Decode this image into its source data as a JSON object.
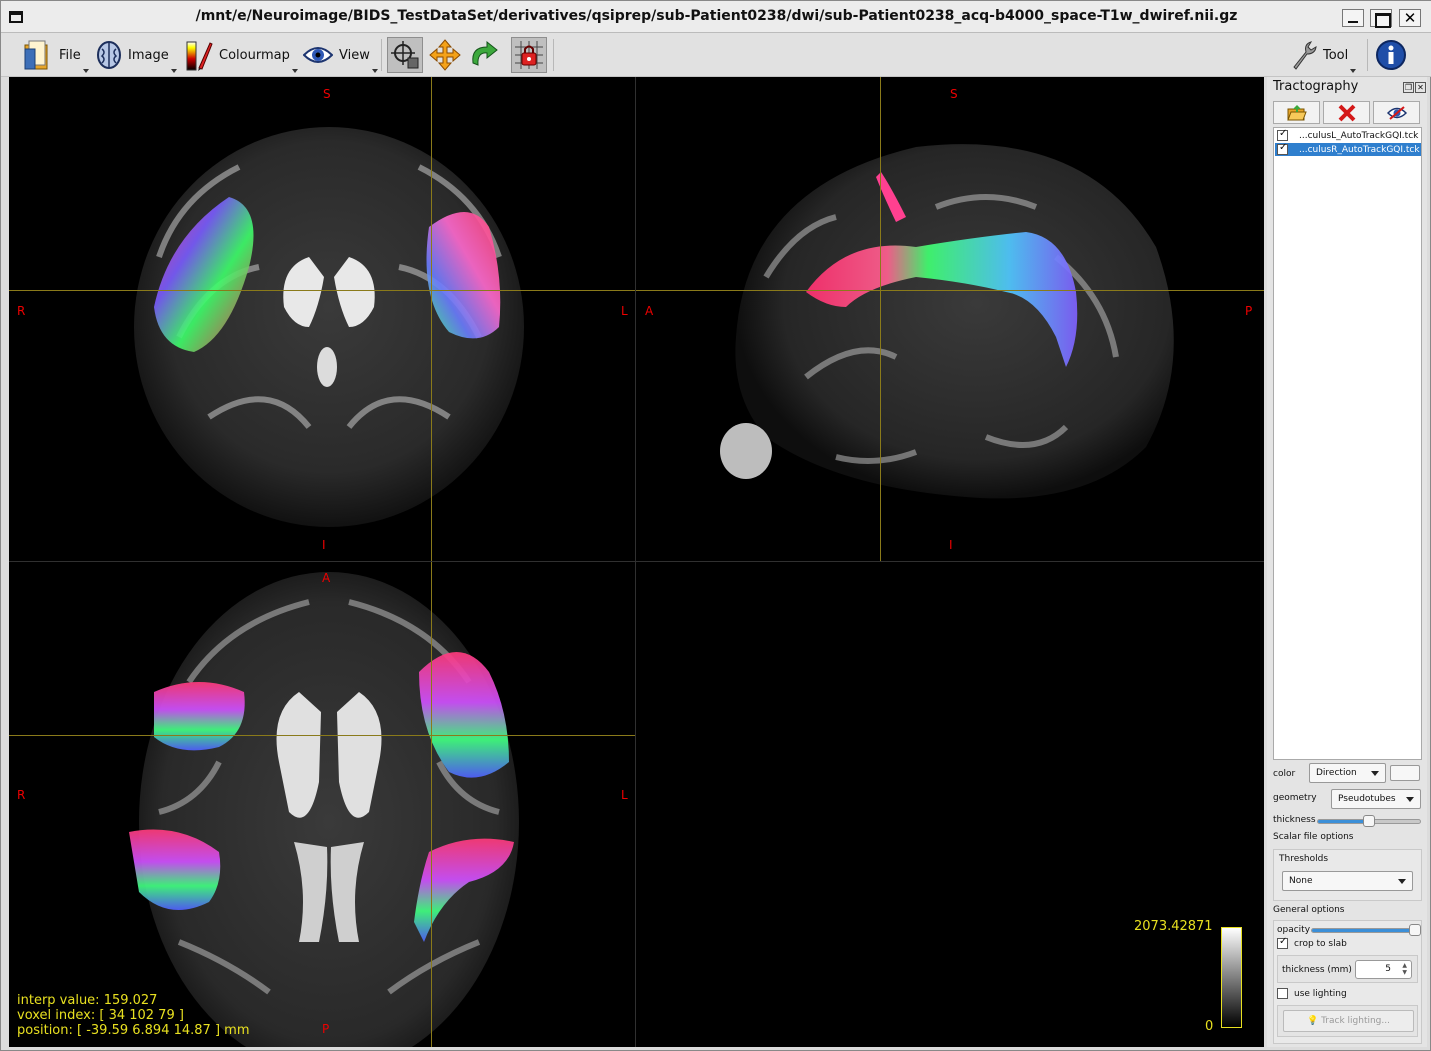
{
  "window": {
    "title": "/mnt/e/Neuroimage/BIDS_TestDataSet/derivatives/qsiprep/sub-Patient0238/dwi/sub-Patient0238_acq-b4000_space-T1w_dwiref.nii.gz",
    "close_glyph": "✕"
  },
  "toolbar": {
    "file_label": "File",
    "image_label": "Image",
    "colourmap_label": "Colourmap",
    "view_label": "View",
    "tool_label": "Tool"
  },
  "views": {
    "coronal": {
      "top": "S",
      "bottom": "I",
      "left": "R",
      "right": "L"
    },
    "sagittal": {
      "top": "S",
      "bottom": "I",
      "left": "A",
      "right": "P"
    },
    "axial": {
      "top": "A",
      "bottom": "P",
      "left": "R",
      "right": "L"
    },
    "info": {
      "interp": "interp value: 159.027",
      "voxel": "voxel index: [ 34 102 79 ]",
      "position": "position: [ -39.59 6.894 14.87 ] mm"
    },
    "colorbar": {
      "max": "2073.42871",
      "min": "0"
    },
    "crosshair_color": "#8a7a1a",
    "label_color": "#e00000",
    "info_color": "#e8e020"
  },
  "tractography": {
    "title": "Tractography",
    "tracks": [
      {
        "name": "...culusL_AutoTrackGQI.tck",
        "checked": true,
        "selected": false
      },
      {
        "name": "...culusR_AutoTrackGQI.tck",
        "checked": true,
        "selected": true
      }
    ],
    "color_label": "color",
    "color_value": "Direction",
    "geometry_label": "geometry",
    "geometry_value": "Pseudotubes",
    "thickness_label": "thickness",
    "thickness_level": 0.5,
    "scalar_heading": "Scalar file options",
    "thresholds_label": "Thresholds",
    "thresholds_value": "None",
    "general_heading": "General options",
    "opacity_label": "opacity",
    "opacity_level": 0.98,
    "crop_label": "crop to slab",
    "crop_checked": true,
    "slab_thickness_label": "thickness (mm)",
    "slab_thickness_value": "5",
    "lighting_label": "use lighting",
    "lighting_checked": false,
    "track_lighting_label": "Track lighting..."
  },
  "colors": {
    "accent": "#2f7fce",
    "view_bg": "#000000"
  }
}
